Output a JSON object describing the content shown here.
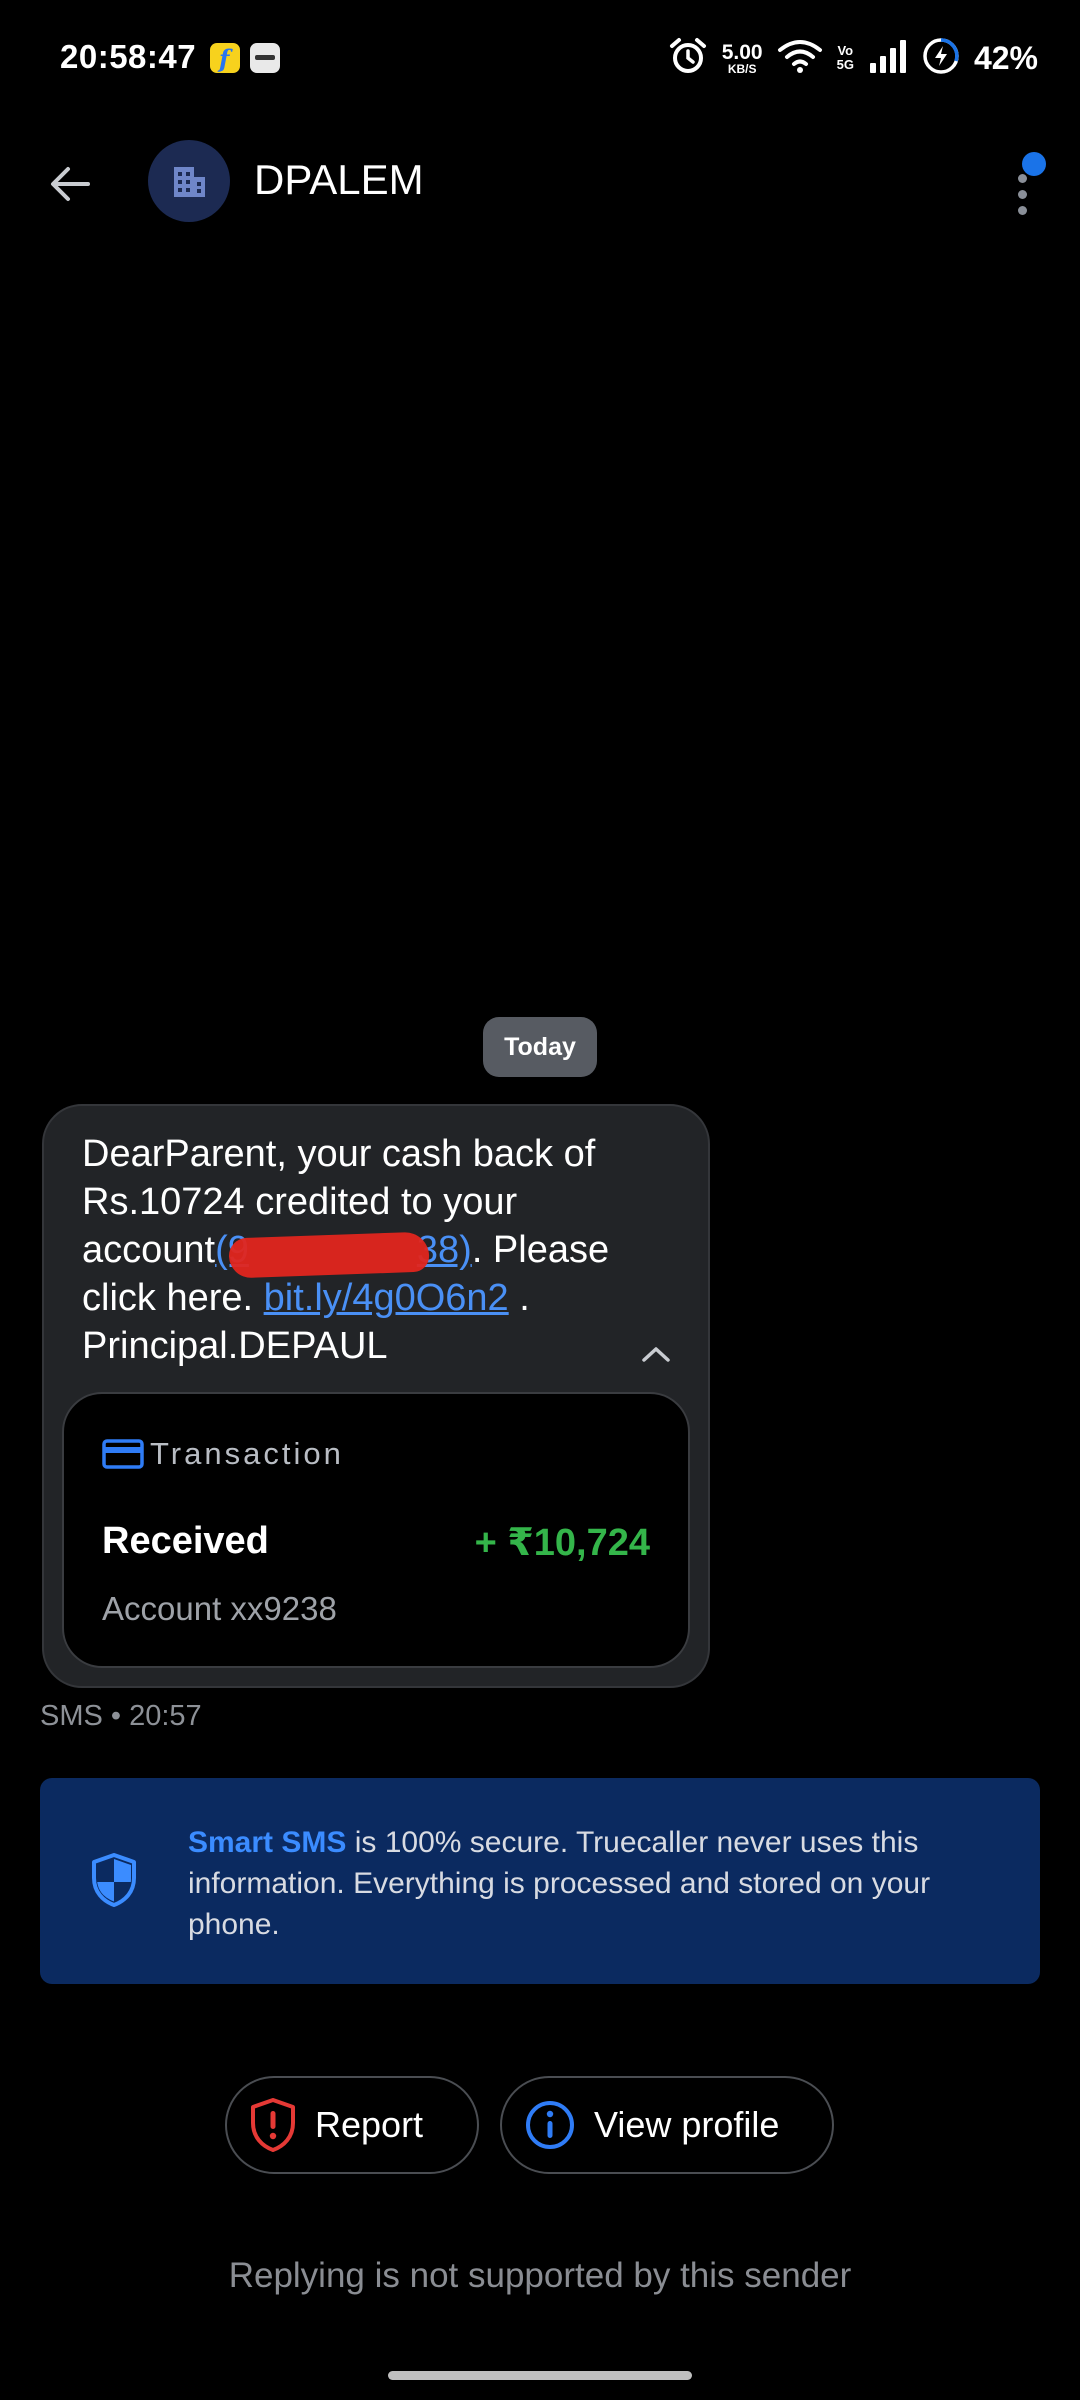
{
  "status_bar": {
    "time": "20:58:47",
    "net_speed_value": "5.00",
    "net_speed_unit": "KB/S",
    "volte_top": "Vo",
    "volte_bottom": "5G",
    "battery": "42%"
  },
  "app_bar": {
    "sender": "DPALEM"
  },
  "conversation": {
    "date_chip": "Today",
    "message": {
      "part1": "DearParent, your cash back of Rs.10724 credited to your account",
      "redacted": "(9",
      "redacted_tail": "38)",
      "part2": ". Please click here. ",
      "link": "bit.ly/4g0O6n2",
      "part3": " . Principal.DEPAUL"
    },
    "transaction": {
      "title": "Transaction",
      "status": "Received",
      "amount": "+ ₹10,724",
      "account": "Account xx9238"
    },
    "meta": "SMS • 20:57"
  },
  "smart_banner": {
    "brand": "Smart SMS",
    "text": " is 100% secure. Truecaller never uses this information. Everything is processed and stored on your phone."
  },
  "actions": {
    "report": "Report",
    "view_profile": "View profile"
  },
  "reply_note": "Replying is not supported by this sender",
  "colors": {
    "accent": "#1a73e8",
    "amount_green": "#34b54a",
    "banner_bg": "#0b2a60",
    "report_red": "#e53935"
  }
}
